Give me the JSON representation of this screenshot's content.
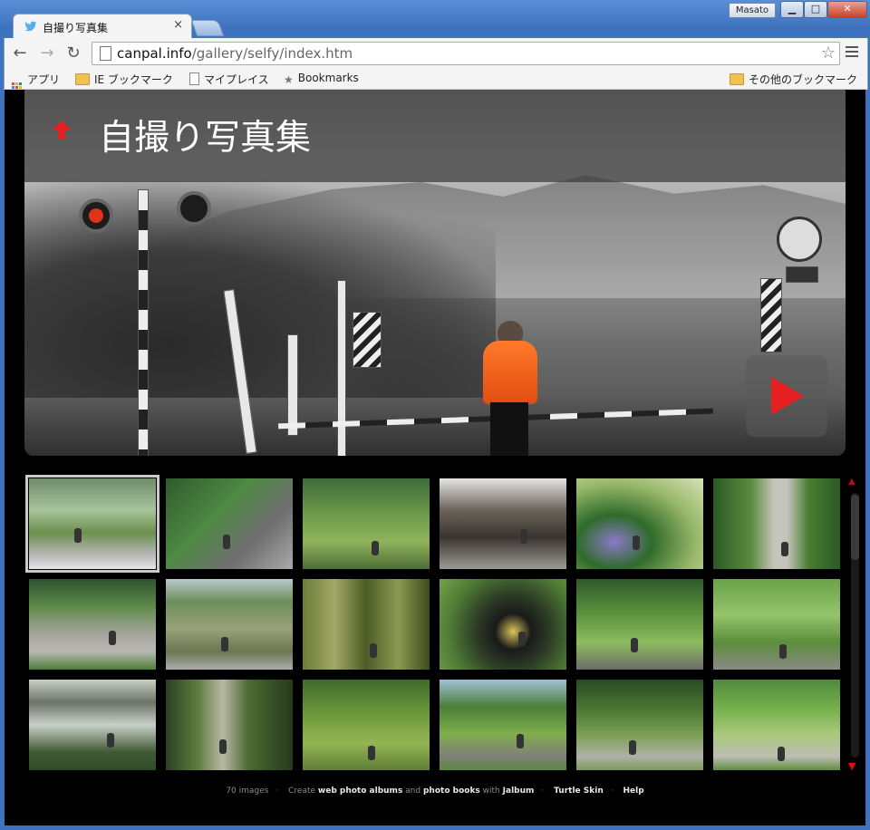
{
  "window": {
    "user": "Masato",
    "minimize": "▁",
    "maximize": "□",
    "close": "✕"
  },
  "tab": {
    "title": "自撮り写真集",
    "close": "×",
    "favicon": "twitter-bird-icon",
    "favicon_color": "#55acee"
  },
  "toolbar": {
    "back": "←",
    "forward": "→",
    "reload": "↻",
    "url_host": "canpal.info",
    "url_path": "/gallery/selfy/index.htm",
    "star": "☆"
  },
  "bookmarks": {
    "apps": "アプリ",
    "ie": "IE ブックマーク",
    "myplace": "マイプレイス",
    "bookmarks": "Bookmarks",
    "other": "その他のブックマーク"
  },
  "gallery": {
    "title": "自撮り写真集",
    "accent": "#e62020",
    "thumbnails": [
      {
        "bg": "linear-gradient(#6f8c6c 0%,#a8c49a 35%,#6b8f4e 60%,#b9b9b9 85%,#e6e6e6 100%)"
      },
      {
        "bg": "linear-gradient(135deg,#2f5a2c 0%,#4f8a45 40%,#6f6f6f 70%,#aaaaaa 100%)"
      },
      {
        "bg": "linear-gradient(#3d6b3a 0%,#6e9b4c 40%,#8fb35a 70%,#4e6d38 100%)"
      },
      {
        "bg": "linear-gradient(#e4e4e4 0%,#6b6358 35%,#3a3530 65%,#9c9a93 100%)"
      },
      {
        "bg": "radial-gradient(ellipse at 30% 70%,#8a79c9 0%,#2f6b2a 30%,#98b86a 65%,#d9e3b9 100%)"
      },
      {
        "bg": "linear-gradient(90deg,#2a5a25 0%,#5c8c3e 30%,#c5c5bb 48%,#c5c5bb 58%,#4a7d32 75%,#2b5a24 100%)"
      },
      {
        "bg": "linear-gradient(#2f5230 0%,#5d8a48 30%,#a5a59c 60%,#b8b8b2 80%,#4d7c39 100%)"
      },
      {
        "bg": "linear-gradient(#b9c7cf 0%,#6c8f59 25%,#9aa17a 55%,#6a7752 80%,#adadad 100%)"
      },
      {
        "bg": "linear-gradient(90deg,#6b7d3a 0%,#a3a865 25%,#4d5c26 50%,#8c9a52 75%,#3e4c1e 100%)"
      },
      {
        "bg": "radial-gradient(circle at 58% 58%,#d9c45c 0%,#1a1a1a 20%,#2b3a25 40%,#4f7b35 70%,#76a04a 100%)"
      },
      {
        "bg": "linear-gradient(#2e5a2a 0%,#5f9440 40%,#8dbb5e 70%,#6c6c68 100%)"
      },
      {
        "bg": "linear-gradient(#6aa34a 0%,#94c46a 40%,#5c8e3b 70%,#8a8a85 100%)"
      },
      {
        "bg": "linear-gradient(#c7d0c4 0%,#6b7466 25%,#c7cfc8 50%,#405b34 80%,#2f4a26 100%)"
      },
      {
        "bg": "linear-gradient(90deg,#2c3f22 0%,#5e7d3e 25%,#b8b8a6 45%,#4c6a33 65%,#263a1c 100%)"
      },
      {
        "bg": "linear-gradient(#3f6a2a 0%,#6f9a3d 40%,#93b553 70%,#5f7d35 100%)"
      },
      {
        "bg": "linear-gradient(#9fbfd6 0%,#4a7f38 30%,#7fae4c 60%,#7f7f7a 85%,#5a8a3a 100%)"
      },
      {
        "bg": "linear-gradient(#2a4a22 0%,#4f7a34 35%,#7a9e52 60%,#b0b0a8 85%,#7a9a56 100%)"
      },
      {
        "bg": "linear-gradient(#4f8a3a 0%,#7ab350 35%,#a9c97a 60%,#bdbdb3 85%,#5d8f3d 100%)"
      }
    ]
  },
  "footer": {
    "count": "70 images",
    "create": "Create",
    "web_albums": "web photo albums",
    "and": "and",
    "photo_books": "photo books",
    "with": "with",
    "jalbum": "Jalbum",
    "skin": "Turtle Skin",
    "help": "Help"
  }
}
